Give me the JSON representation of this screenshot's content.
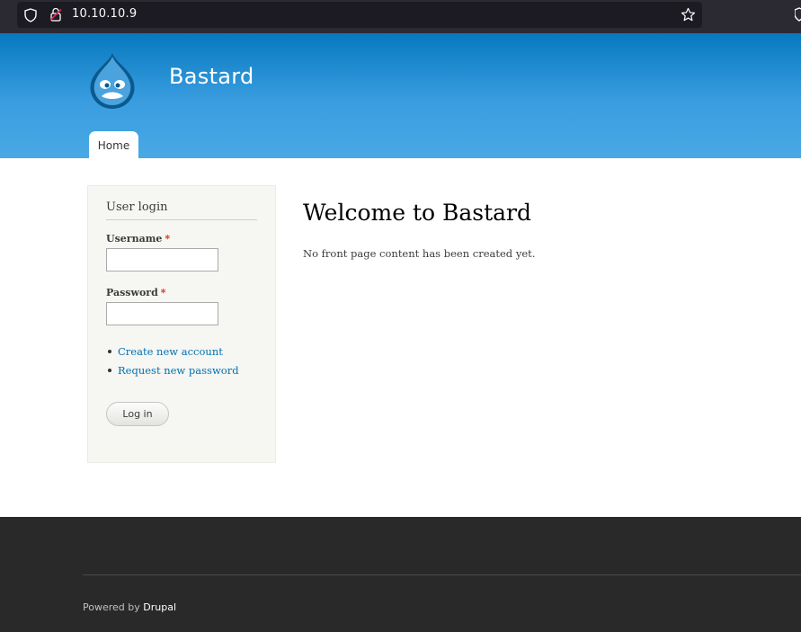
{
  "browser": {
    "url": "10.10.10.9",
    "icons": [
      "shield-icon",
      "lock-slash-icon",
      "star-icon"
    ]
  },
  "header": {
    "site_name": "Bastard",
    "logo_icon": "drupal-drop-logo",
    "tabs": [
      {
        "label": "Home",
        "active": true
      }
    ]
  },
  "sidebar": {
    "block_title": "User login",
    "username_label": "Username",
    "password_label": "Password",
    "required_mark": "*",
    "username_value": "",
    "password_value": "",
    "links": [
      "Create new account",
      "Request new password"
    ],
    "login_button": "Log in"
  },
  "main": {
    "title": "Welcome to Bastard",
    "body": "No front page content has been created yet."
  },
  "footer": {
    "powered_prefix": "Powered by",
    "powered_link": "Drupal"
  },
  "colors": {
    "header_top": "#0779bf",
    "header_bottom": "#48a9e4",
    "link": "#0071b3",
    "required": "#ea2800",
    "footer_bg": "#292929"
  }
}
